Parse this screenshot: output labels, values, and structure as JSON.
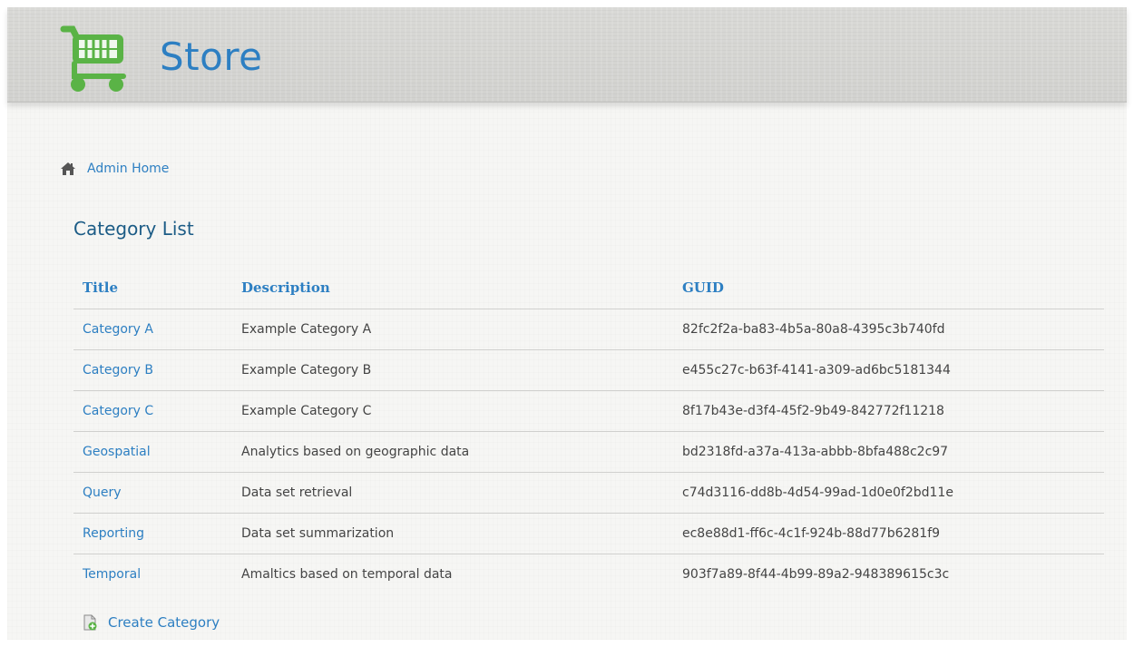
{
  "header": {
    "title": "Store",
    "logo_icon": "shopping-cart-icon"
  },
  "breadcrumb": {
    "icon": "home-icon",
    "label": "Admin Home"
  },
  "main": {
    "title": "Category List",
    "table": {
      "columns": [
        "Title",
        "Description",
        "GUID"
      ],
      "rows": [
        {
          "title": "Category A",
          "description": "Example Category A",
          "guid": "82fc2f2a-ba83-4b5a-80a8-4395c3b740fd"
        },
        {
          "title": "Category B",
          "description": "Example Category B",
          "guid": "e455c27c-b63f-4141-a309-ad6bc5181344"
        },
        {
          "title": "Category C",
          "description": "Example Category C",
          "guid": "8f17b43e-d3f4-45f2-9b49-842772f11218"
        },
        {
          "title": "Geospatial",
          "description": "Analytics based on geographic data",
          "guid": "bd2318fd-a37a-413a-abbb-8bfa488c2c97"
        },
        {
          "title": "Query",
          "description": "Data set retrieval",
          "guid": "c74d3116-dd8b-4d54-99ad-1d0e0f2bd11e"
        },
        {
          "title": "Reporting",
          "description": "Data set summarization",
          "guid": "ec8e88d1-ff6c-4c1f-924b-88d77b6281f9"
        },
        {
          "title": "Temporal",
          "description": "Amaltics based on temporal data",
          "guid": "903f7a89-8f44-4b99-89a2-948389615c3c"
        }
      ]
    },
    "create": {
      "icon": "add-document-icon",
      "label": "Create Category"
    }
  },
  "colors": {
    "accent": "#2d7fc2",
    "title": "#1c5c86",
    "logo_green": "#5ab346",
    "text": "#444444"
  }
}
